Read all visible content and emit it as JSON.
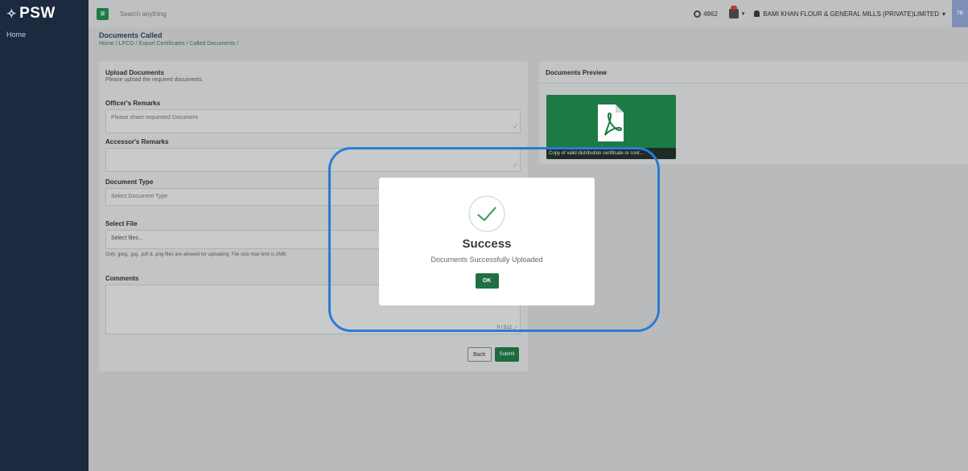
{
  "brand": {
    "logo_text": "PSW",
    "logo_mark": "✧"
  },
  "sidebar": {
    "items": [
      {
        "label": "Home"
      }
    ]
  },
  "topbar": {
    "menu_icon": "≡",
    "search_placeholder": "Search anything",
    "counter_value": "4962",
    "company_name": "BAMI KHAN FLOUR & GENERAL MILLS (PRIVATE)LIMITED",
    "company_caret": "▾",
    "bell_caret": "▾",
    "avatar_initials": "TB"
  },
  "page": {
    "title": "Documents Called",
    "breadcrumb": "Home / LPCO / Export Certificates / Called Documents /"
  },
  "upload_card": {
    "title": "Upload Documents",
    "subtitle": "Please upload the required documents",
    "officer_remarks_label": "Officer's Remarks",
    "officer_remarks_value": "Please share requested Document",
    "accessor_remarks_label": "Accessor's Remarks",
    "accessor_remarks_value": "",
    "document_type_label": "Document Type",
    "document_type_placeholder": "Select Document Type",
    "select_file_label": "Select File",
    "select_file_button": "Select files...",
    "file_help": "Only .jpeg, .jpg, .pdf & .png files are allowed for uploading. File size max limit is 2MB.",
    "comments_label": "Comments",
    "comments_counter": "0 / 512",
    "back_label": "Back",
    "submit_label": "Submit"
  },
  "preview_card": {
    "title": "Documents Preview",
    "doc_caption": "Copy of valid distribution certificate or cont..."
  },
  "modal": {
    "title": "Success",
    "message": "Documents Successfully Uploaded",
    "ok_label": "OK"
  },
  "colors": {
    "sidebar": "#1b2a3f",
    "accent_green": "#1f7045",
    "highlight_ring": "#2a7bd5"
  }
}
